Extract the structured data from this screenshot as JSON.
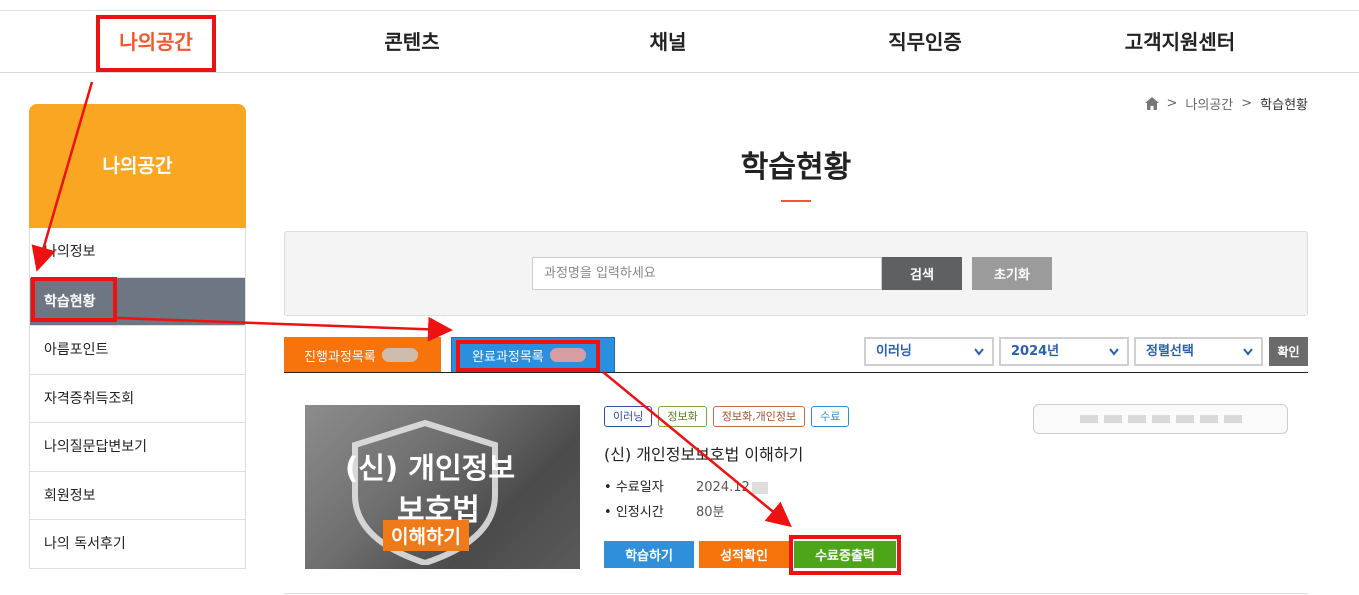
{
  "nav": {
    "items": [
      "나의공간",
      "콘텐츠",
      "채널",
      "직무인증",
      "고객지원센터"
    ],
    "active_index": 0
  },
  "sidebar": {
    "title": "나의공간",
    "items": [
      "나의정보",
      "학습현황",
      "아름포인트",
      "자격증취득조회",
      "나의질문답변보기",
      "회원정보",
      "나의 독서후기"
    ],
    "active_index": 1
  },
  "breadcrumb": {
    "sep": ">",
    "items": [
      "나의공간",
      "학습현황"
    ]
  },
  "page": {
    "title": "학습현황"
  },
  "search": {
    "placeholder": "과정명을 입력하세요",
    "search_label": "검색",
    "reset_label": "초기화"
  },
  "tabs": [
    {
      "label": "진행과정목록"
    },
    {
      "label": "완료과정목록"
    }
  ],
  "filters": {
    "type": "이러닝",
    "year": "2024년",
    "sort": "정렬선택",
    "confirm_label": "확인"
  },
  "course": {
    "thumbnail": {
      "line1": "(신) 개인정보",
      "line2": "보호법",
      "line3": "이해하기"
    },
    "tags": [
      "이러닝",
      "정보화",
      "정보화,개인정보",
      "수료"
    ],
    "title": "(신) 개인정보보호법 이해하기",
    "info": [
      {
        "label": "수료일자",
        "value": "2024.12"
      },
      {
        "label": "인정시간",
        "value": "80분"
      }
    ],
    "buttons": {
      "study": "학습하기",
      "grade": "성적확인",
      "certificate": "수료증출력"
    }
  },
  "colors": {
    "accent": "#f0572d",
    "sidebar_head": "#f9a723",
    "tab_progress": "#f6740b",
    "tab_done": "#2a8fde",
    "annotation": "#ee1111"
  }
}
